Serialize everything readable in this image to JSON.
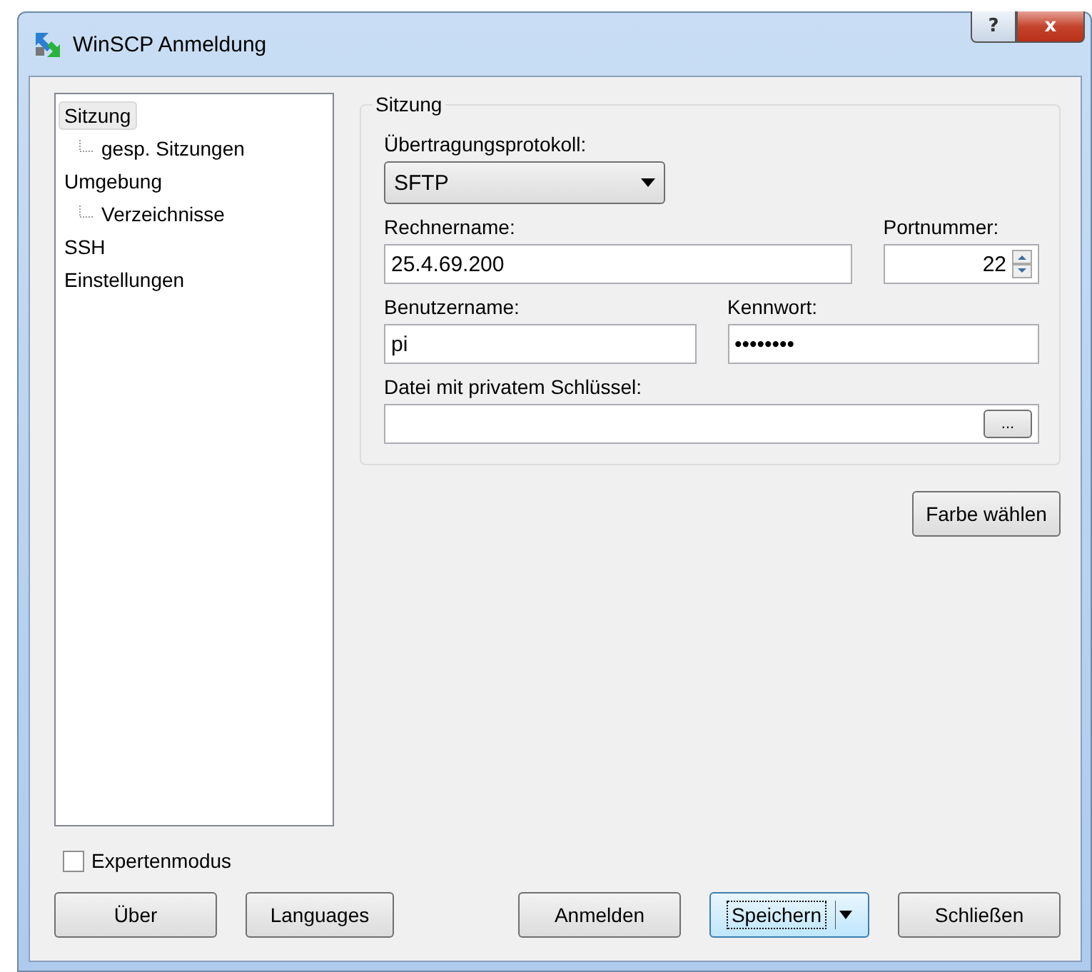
{
  "window": {
    "title": "WinSCP Anmeldung",
    "help_button": "?",
    "close_button": "x"
  },
  "tree": [
    {
      "label": "Sitzung",
      "selected": true,
      "children": [
        {
          "label": "gesp. Sitzungen",
          "selected": false
        }
      ]
    },
    {
      "label": "Umgebung",
      "selected": false,
      "children": [
        {
          "label": "Verzeichnisse",
          "selected": false
        }
      ]
    },
    {
      "label": "SSH",
      "selected": false
    },
    {
      "label": "Einstellungen",
      "selected": false
    }
  ],
  "session": {
    "legend": "Sitzung",
    "protocol_label": "Übertragungsprotokoll:",
    "protocol": "SFTP",
    "host_label": "Rechnername:",
    "host": "25.4.69.200",
    "port_label": "Portnummer:",
    "port": "22",
    "user_label": "Benutzername:",
    "user": "pi",
    "password_label": "Kennwort:",
    "password": "••••••••",
    "key_label": "Datei mit privatem Schlüssel:",
    "browse_button": "..."
  },
  "color_button": "Farbe wählen",
  "expert_mode": {
    "label": "Expertenmodus",
    "checked": false
  },
  "buttons": [
    {
      "label": "Über",
      "kind": "plain",
      "focused": false
    },
    {
      "label": "Languages",
      "kind": "plain",
      "focused": false
    },
    {
      "label": "Anmelden",
      "kind": "plain",
      "focused": false
    },
    {
      "label": "Speichern",
      "kind": "split",
      "focused": true
    },
    {
      "label": "Schließen",
      "kind": "plain",
      "focused": false
    }
  ]
}
